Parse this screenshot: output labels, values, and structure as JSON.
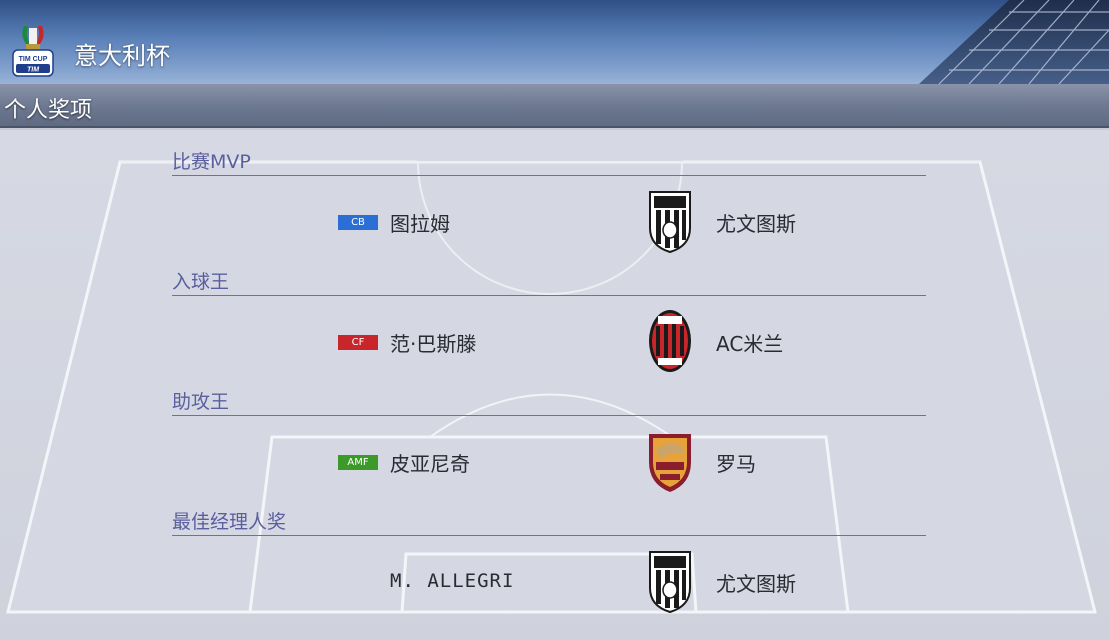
{
  "header": {
    "title": "意大利杯",
    "logo_text_top": "TIM CUP",
    "logo_text_bottom": "TIM"
  },
  "subbar": {
    "title": "个人奖项"
  },
  "awards": [
    {
      "category": "比赛MVP",
      "position": "CB",
      "position_color": "#2b6fd6",
      "winner": "图拉姆",
      "club": "尤文图斯",
      "crest": "juventus-crest-icon"
    },
    {
      "category": "入球王",
      "position": "CF",
      "position_color": "#c8262b",
      "winner": "范·巴斯滕",
      "club": "AC米兰",
      "crest": "ac-milan-crest-icon"
    },
    {
      "category": "助攻王",
      "position": "AMF",
      "position_color": "#3c9a2a",
      "winner": "皮亚尼奇",
      "club": "罗马",
      "crest": "as-roma-crest-icon"
    },
    {
      "category": "最佳经理人奖",
      "winner": "M. ALLEGRI",
      "club": "尤文图斯",
      "crest": "juventus-crest-icon"
    }
  ]
}
